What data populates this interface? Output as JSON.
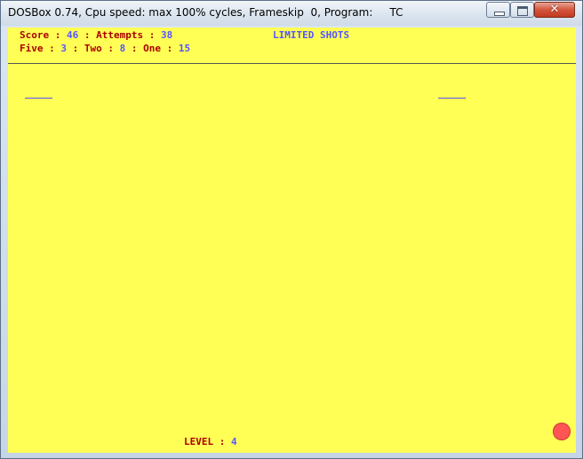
{
  "window": {
    "title": "DOSBox 0.74, Cpu speed: max 100% cycles, Frameskip  0, Program:     TC",
    "close_glyph": "✕"
  },
  "hud": {
    "score_label": "Score : ",
    "score_value": "46",
    "attempts_label": " : Attempts : ",
    "attempts_value": "38",
    "mode_label": "LIMITED SHOTS",
    "five_label": "Five : ",
    "five_value": "3",
    "two_label": " : Two : ",
    "two_value": "8",
    "one_label": " : One : ",
    "one_value": "15",
    "level_label": "LEVEL : ",
    "level_value": "4"
  },
  "colors": {
    "background": "#ffff55",
    "label": "#aa0000",
    "value": "#5555ff",
    "ball": "#ff5555",
    "divider": "#555555"
  },
  "icons": {
    "minimize": "minimize-icon",
    "maximize": "maximize-icon",
    "close": "close-icon"
  }
}
